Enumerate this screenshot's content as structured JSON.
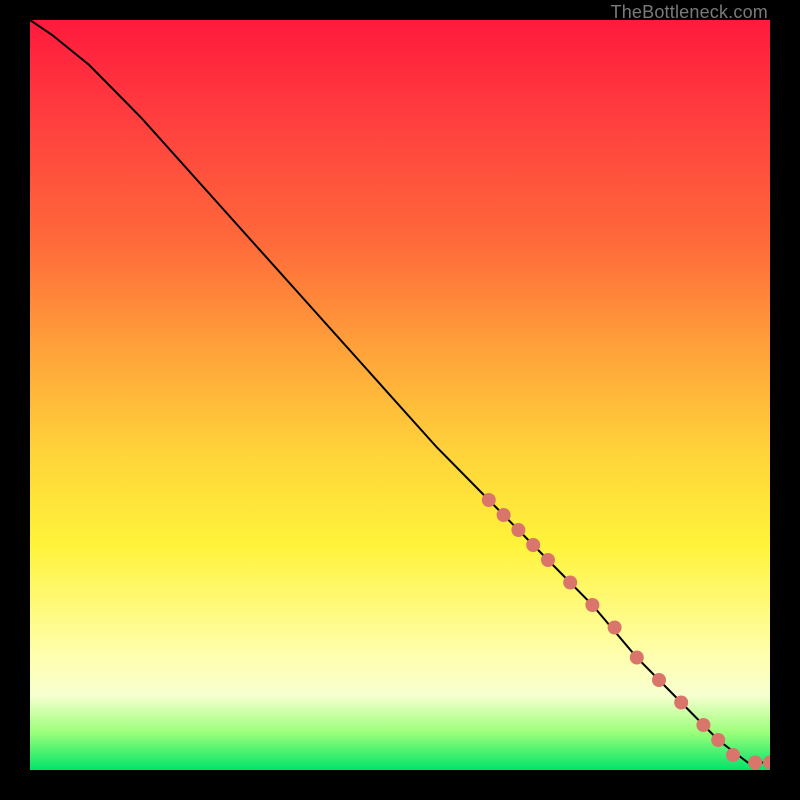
{
  "attribution": "TheBottleneck.com",
  "colors": {
    "background_frame": "#000000",
    "gradient_stops": [
      "#ff1a3d",
      "#ff3b3f",
      "#ff6b3a",
      "#ffa63a",
      "#ffd43a",
      "#fff33a",
      "#ffffb0",
      "#f7ffd0",
      "#9cff7a",
      "#00e46a"
    ],
    "curve": "#000000",
    "dot": "#d9756a"
  },
  "chart_data": {
    "type": "line",
    "title": "",
    "xlabel": "",
    "ylabel": "",
    "xlim": [
      0,
      100
    ],
    "ylim": [
      0,
      100
    ],
    "grid": false,
    "legend": false,
    "series": [
      {
        "name": "curve",
        "x": [
          0,
          3,
          8,
          15,
          25,
          35,
          45,
          55,
          62,
          70,
          76,
          82,
          88,
          93,
          97,
          100
        ],
        "y": [
          100,
          98,
          94,
          87,
          76,
          65,
          54,
          43,
          36,
          28,
          22,
          15,
          9,
          4,
          1,
          1
        ]
      }
    ],
    "scatter_points": {
      "name": "highlighted-segment",
      "x": [
        62,
        64,
        66,
        68,
        70,
        73,
        76,
        79,
        82,
        85,
        88,
        91,
        93,
        95,
        98,
        100
      ],
      "y": [
        36,
        34,
        32,
        30,
        28,
        25,
        22,
        19,
        15,
        12,
        9,
        6,
        4,
        2,
        1,
        1
      ]
    }
  }
}
